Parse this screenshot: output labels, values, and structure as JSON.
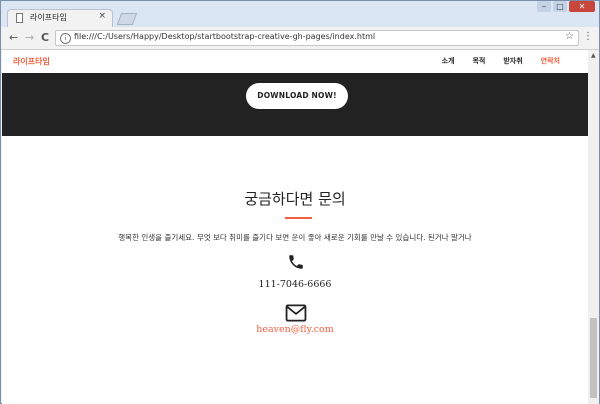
{
  "browser": {
    "tab_title": "라이프타임",
    "tab_close": "×",
    "url": "file:///C:/Users/Happy/Desktop/startbootstrap-creative-gh-pages/index.html",
    "back": "←",
    "forward": "→",
    "reload": "C",
    "star": "☆",
    "menu": "⋮"
  },
  "site": {
    "brand": "라이프타임",
    "nav": [
      "소개",
      "목적",
      "받자취",
      "연락처"
    ],
    "hero_button": "DOWNLOAD NOW!",
    "contact": {
      "heading": "궁금하다면 문의",
      "lead": "행복한 인생을 즐기세요. 무엇 보다 취미를 즐기다 보면 운이 좋아 새로운 기회를 만날 수 있습니다. 된거나 말거나",
      "phone": "111-7046-6666",
      "email": "heaven@fly.com"
    }
  },
  "colors": {
    "accent": "#f05f40",
    "hero_bg": "#222222"
  },
  "icons": [
    "phone-icon",
    "envelope-icon"
  ]
}
